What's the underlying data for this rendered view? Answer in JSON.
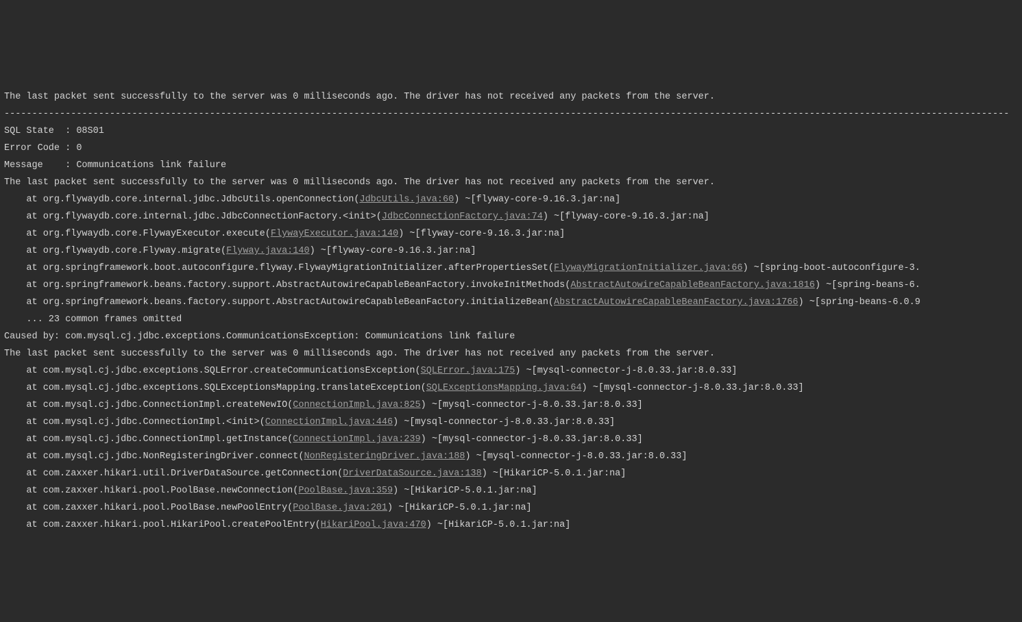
{
  "lines": [
    {
      "type": "plain",
      "text": "The last packet sent successfully to the server was 0 milliseconds ago. The driver has not received any packets from the server."
    },
    {
      "type": "plain",
      "text": "-------------------------------------------------------------------------------------------------------------------------------------------------------------------------------------"
    },
    {
      "type": "plain",
      "text": "SQL State  : 08S01"
    },
    {
      "type": "plain",
      "text": "Error Code : 0"
    },
    {
      "type": "plain",
      "text": "Message    : Communications link failure"
    },
    {
      "type": "plain",
      "text": ""
    },
    {
      "type": "plain",
      "text": "The last packet sent successfully to the server was 0 milliseconds ago. The driver has not received any packets from the server."
    },
    {
      "type": "plain",
      "text": ""
    },
    {
      "type": "frame",
      "before": "    at org.flywaydb.core.internal.jdbc.JdbcUtils.openConnection(",
      "link": "JdbcUtils.java:60",
      "after": ") ~[flyway-core-9.16.3.jar:na]"
    },
    {
      "type": "frame",
      "before": "    at org.flywaydb.core.internal.jdbc.JdbcConnectionFactory.<init>(",
      "link": "JdbcConnectionFactory.java:74",
      "after": ") ~[flyway-core-9.16.3.jar:na]"
    },
    {
      "type": "frame",
      "before": "    at org.flywaydb.core.FlywayExecutor.execute(",
      "link": "FlywayExecutor.java:140",
      "after": ") ~[flyway-core-9.16.3.jar:na]"
    },
    {
      "type": "frame",
      "before": "    at org.flywaydb.core.Flyway.migrate(",
      "link": "Flyway.java:140",
      "after": ") ~[flyway-core-9.16.3.jar:na]"
    },
    {
      "type": "frame",
      "before": "    at org.springframework.boot.autoconfigure.flyway.FlywayMigrationInitializer.afterPropertiesSet(",
      "link": "FlywayMigrationInitializer.java:66",
      "after": ") ~[spring-boot-autoconfigure-3."
    },
    {
      "type": "frame",
      "before": "    at org.springframework.beans.factory.support.AbstractAutowireCapableBeanFactory.invokeInitMethods(",
      "link": "AbstractAutowireCapableBeanFactory.java:1816",
      "after": ") ~[spring-beans-6."
    },
    {
      "type": "frame",
      "before": "    at org.springframework.beans.factory.support.AbstractAutowireCapableBeanFactory.initializeBean(",
      "link": "AbstractAutowireCapableBeanFactory.java:1766",
      "after": ") ~[spring-beans-6.0.9"
    },
    {
      "type": "plain",
      "text": "    ... 23 common frames omitted"
    },
    {
      "type": "plain",
      "text": "Caused by: com.mysql.cj.jdbc.exceptions.CommunicationsException: Communications link failure"
    },
    {
      "type": "plain",
      "text": ""
    },
    {
      "type": "plain",
      "text": "The last packet sent successfully to the server was 0 milliseconds ago. The driver has not received any packets from the server."
    },
    {
      "type": "frame",
      "before": "    at com.mysql.cj.jdbc.exceptions.SQLError.createCommunicationsException(",
      "link": "SQLError.java:175",
      "after": ") ~[mysql-connector-j-8.0.33.jar:8.0.33]"
    },
    {
      "type": "frame",
      "before": "    at com.mysql.cj.jdbc.exceptions.SQLExceptionsMapping.translateException(",
      "link": "SQLExceptionsMapping.java:64",
      "after": ") ~[mysql-connector-j-8.0.33.jar:8.0.33]"
    },
    {
      "type": "frame",
      "before": "    at com.mysql.cj.jdbc.ConnectionImpl.createNewIO(",
      "link": "ConnectionImpl.java:825",
      "after": ") ~[mysql-connector-j-8.0.33.jar:8.0.33]"
    },
    {
      "type": "frame",
      "before": "    at com.mysql.cj.jdbc.ConnectionImpl.<init>(",
      "link": "ConnectionImpl.java:446",
      "after": ") ~[mysql-connector-j-8.0.33.jar:8.0.33]"
    },
    {
      "type": "frame",
      "before": "    at com.mysql.cj.jdbc.ConnectionImpl.getInstance(",
      "link": "ConnectionImpl.java:239",
      "after": ") ~[mysql-connector-j-8.0.33.jar:8.0.33]"
    },
    {
      "type": "frame",
      "before": "    at com.mysql.cj.jdbc.NonRegisteringDriver.connect(",
      "link": "NonRegisteringDriver.java:188",
      "after": ") ~[mysql-connector-j-8.0.33.jar:8.0.33]"
    },
    {
      "type": "frame",
      "before": "    at com.zaxxer.hikari.util.DriverDataSource.getConnection(",
      "link": "DriverDataSource.java:138",
      "after": ") ~[HikariCP-5.0.1.jar:na]"
    },
    {
      "type": "frame",
      "before": "    at com.zaxxer.hikari.pool.PoolBase.newConnection(",
      "link": "PoolBase.java:359",
      "after": ") ~[HikariCP-5.0.1.jar:na]"
    },
    {
      "type": "frame",
      "before": "    at com.zaxxer.hikari.pool.PoolBase.newPoolEntry(",
      "link": "PoolBase.java:201",
      "after": ") ~[HikariCP-5.0.1.jar:na]"
    },
    {
      "type": "frame",
      "before": "    at com.zaxxer.hikari.pool.HikariPool.createPoolEntry(",
      "link": "HikariPool.java:470",
      "after": ") ~[HikariCP-5.0.1.jar:na]"
    }
  ]
}
